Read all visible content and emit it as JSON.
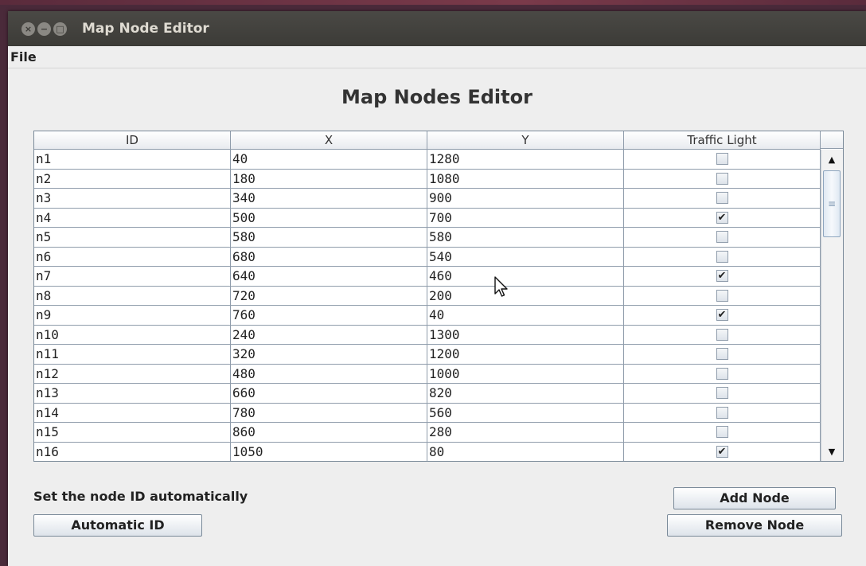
{
  "window": {
    "title": "Map Node Editor",
    "close_glyph": "×",
    "minimize_glyph": "−",
    "maximize_glyph": "□"
  },
  "menu": {
    "file_label": "File"
  },
  "heading": "Map Nodes Editor",
  "table": {
    "columns": [
      "ID",
      "X",
      "Y",
      "Traffic Light"
    ],
    "rows": [
      {
        "id": "n1",
        "x": "40",
        "y": "1280",
        "traffic_light": false
      },
      {
        "id": "n2",
        "x": "180",
        "y": "1080",
        "traffic_light": false
      },
      {
        "id": "n3",
        "x": "340",
        "y": "900",
        "traffic_light": false
      },
      {
        "id": "n4",
        "x": "500",
        "y": "700",
        "traffic_light": true
      },
      {
        "id": "n5",
        "x": "580",
        "y": "580",
        "traffic_light": false
      },
      {
        "id": "n6",
        "x": "680",
        "y": "540",
        "traffic_light": false
      },
      {
        "id": "n7",
        "x": "640",
        "y": "460",
        "traffic_light": true
      },
      {
        "id": "n8",
        "x": "720",
        "y": "200",
        "traffic_light": false
      },
      {
        "id": "n9",
        "x": "760",
        "y": "40",
        "traffic_light": true
      },
      {
        "id": "n10",
        "x": "240",
        "y": "1300",
        "traffic_light": false
      },
      {
        "id": "n11",
        "x": "320",
        "y": "1200",
        "traffic_light": false
      },
      {
        "id": "n12",
        "x": "480",
        "y": "1000",
        "traffic_light": false
      },
      {
        "id": "n13",
        "x": "660",
        "y": "820",
        "traffic_light": false
      },
      {
        "id": "n14",
        "x": "780",
        "y": "560",
        "traffic_light": false
      },
      {
        "id": "n15",
        "x": "860",
        "y": "280",
        "traffic_light": false
      },
      {
        "id": "n16",
        "x": "1050",
        "y": "80",
        "traffic_light": true
      }
    ],
    "check_glyph": "✔",
    "scroll_up_glyph": "▲",
    "scroll_down_glyph": "▼",
    "thumb_grip_glyph": "≡"
  },
  "auto_id_label": "Set the node ID automatically",
  "buttons": {
    "automatic_id": "Automatic ID",
    "add_node": "Add Node",
    "remove_node": "Remove Node"
  },
  "icons": {
    "cursor": "mouse-pointer-icon"
  }
}
